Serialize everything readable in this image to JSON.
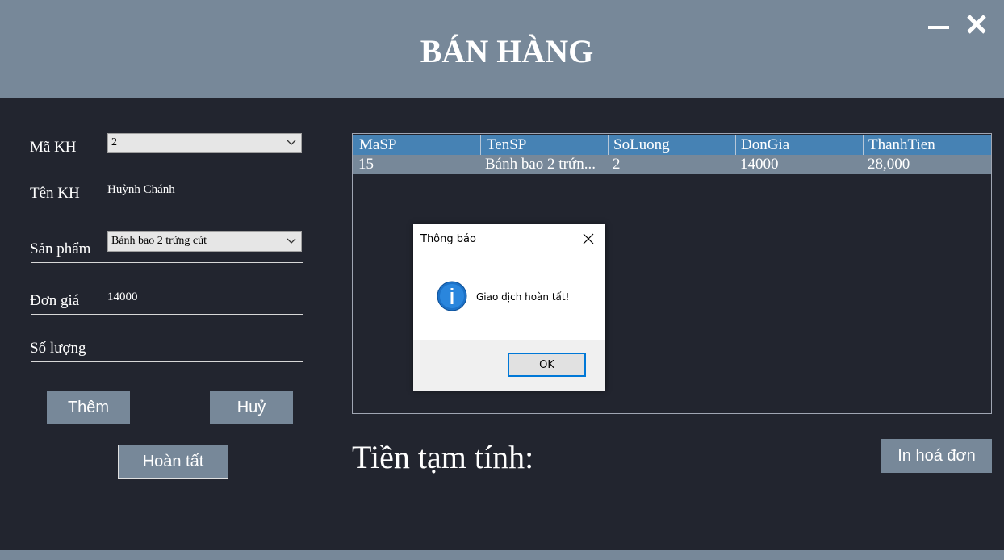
{
  "header": {
    "title": "BÁN HÀNG"
  },
  "form": {
    "ma_kh_label": "Mã KH",
    "ma_kh_value": "2",
    "ten_kh_label": "Tên KH",
    "ten_kh_value": "Huỳnh Chánh",
    "san_pham_label": "Sản phẩm",
    "san_pham_value": "Bánh bao 2 trứng cút",
    "don_gia_label": "Đơn giá",
    "don_gia_value": "14000",
    "so_luong_label": "Số lượng",
    "so_luong_value": ""
  },
  "buttons": {
    "them": "Thêm",
    "huy": "Huỷ",
    "hoan_tat": "Hoàn tất",
    "in_hoa_don": "In hoá đơn"
  },
  "table": {
    "columns": [
      "MaSP",
      "TenSP",
      "SoLuong",
      "DonGia",
      "ThanhTien"
    ],
    "rows": [
      [
        "15",
        "Bánh bao 2 trứn...",
        "2",
        "14000",
        "28,000"
      ]
    ]
  },
  "subtotal_label": "Tiền tạm tính:",
  "dialog": {
    "title": "Thông báo",
    "message": "Giao dịch hoàn tất!",
    "ok": "OK",
    "icon": "info-icon"
  },
  "colors": {
    "background": "#22252f",
    "header": "#778899",
    "grid_header": "#4682b4",
    "button": "#778899",
    "dialog_ok_border": "#0078d7"
  }
}
